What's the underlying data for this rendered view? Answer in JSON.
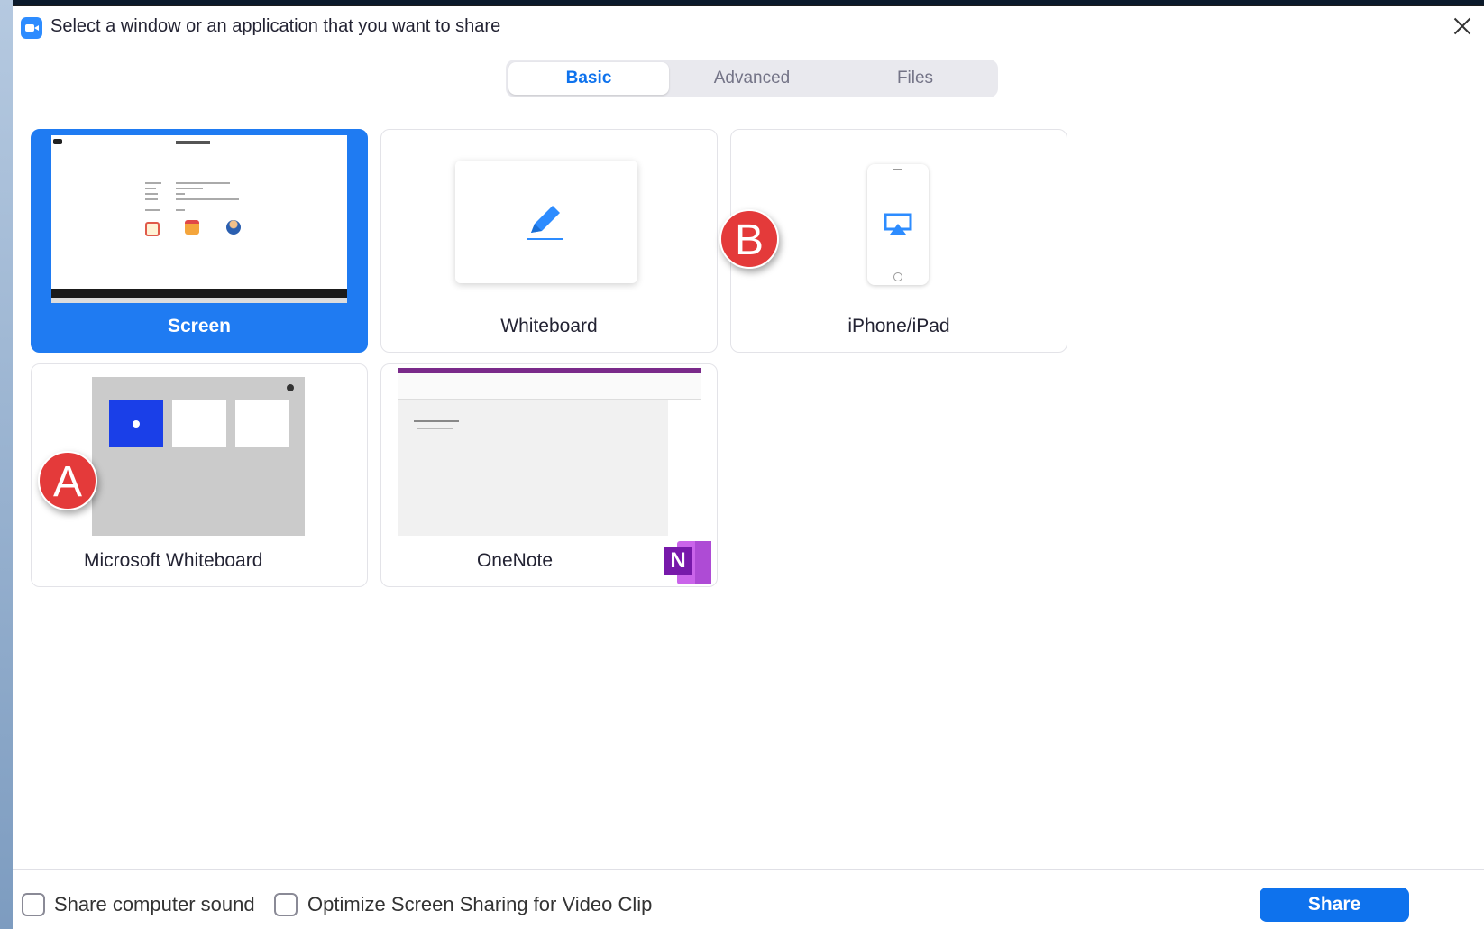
{
  "window": {
    "title": "Select a window or an application that you want to share"
  },
  "tabs": [
    {
      "label": "Basic",
      "active": true
    },
    {
      "label": "Advanced",
      "active": false
    },
    {
      "label": "Files",
      "active": false
    }
  ],
  "cards": [
    {
      "label": "Screen",
      "selected": true
    },
    {
      "label": "Whiteboard",
      "selected": false
    },
    {
      "label": "iPhone/iPad",
      "selected": false
    },
    {
      "label": "Microsoft Whiteboard",
      "selected": false
    },
    {
      "label": "OneNote",
      "selected": false
    }
  ],
  "onenote_logo_letter": "N",
  "annotations": {
    "a": "A",
    "b": "B",
    "color": "#e43a3a"
  },
  "footer": {
    "share_sound_label": "Share computer sound",
    "optimize_label": "Optimize Screen Sharing for Video Clip",
    "share_sound_checked": false,
    "optimize_checked": false,
    "share_button_label": "Share"
  },
  "colors": {
    "accent": "#0e72ed",
    "selected_card": "#1f7bf2"
  }
}
